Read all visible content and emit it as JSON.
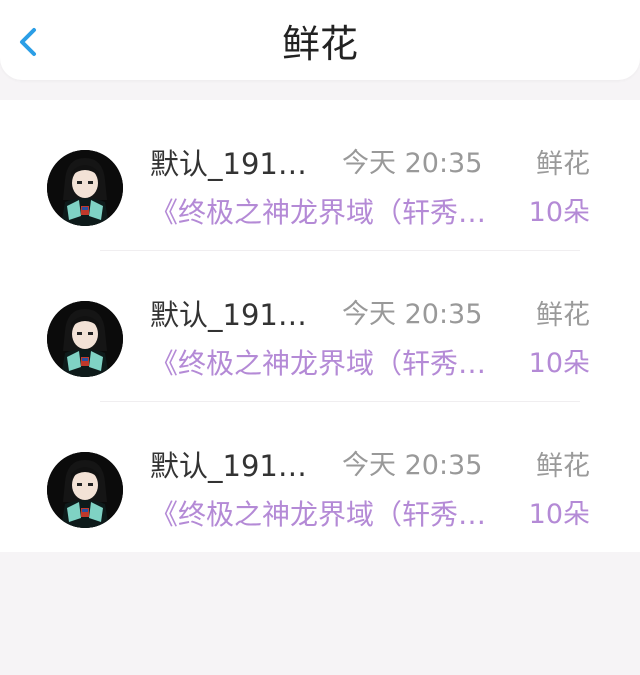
{
  "header": {
    "title": "鲜花",
    "back_icon": "chevron-left-icon"
  },
  "colors": {
    "accent_blue": "#2b9ee6",
    "purple": "#b48ad6"
  },
  "records": [
    {
      "user": "默认_191…",
      "time": "今天 20:35",
      "gift_type": "鲜花",
      "book": "《终极之神龙界域（轩秀…",
      "count": "10朵",
      "avatar_icon": "user-avatar"
    },
    {
      "user": "默认_191…",
      "time": "今天 20:35",
      "gift_type": "鲜花",
      "book": "《终极之神龙界域（轩秀…",
      "count": "10朵",
      "avatar_icon": "user-avatar"
    },
    {
      "user": "默认_191…",
      "time": "今天 20:35",
      "gift_type": "鲜花",
      "book": "《终极之神龙界域（轩秀…",
      "count": "10朵",
      "avatar_icon": "user-avatar"
    }
  ]
}
